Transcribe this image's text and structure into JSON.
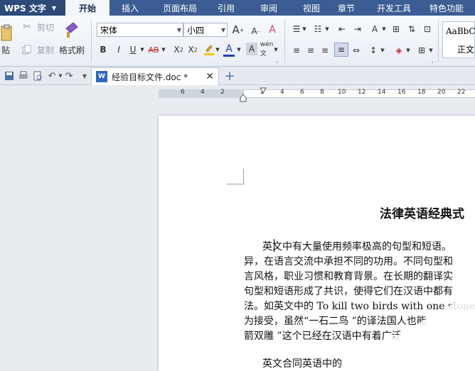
{
  "menu": {
    "app_name": "WPS 文字",
    "tabs": [
      "开始",
      "插入",
      "页面布局",
      "引用",
      "审阅",
      "视图",
      "章节",
      "开发工具",
      "特色功能"
    ]
  },
  "ribbon": {
    "paste": "贴",
    "cut": "剪切",
    "copy": "复制",
    "format_painter": "格式刷",
    "font_name": "宋体",
    "font_size": "小四",
    "style_preview": "AaBbC",
    "style_name": "正文"
  },
  "qbar": {
    "doc_name": "经验目标文件.doc *"
  },
  "ruler": {
    "ticks": [
      "6",
      "4",
      "2",
      "2",
      "4",
      "6",
      "8",
      "10",
      "12",
      "14",
      "16",
      "18",
      "20",
      "22"
    ]
  },
  "document": {
    "title": "法律英语经典式",
    "lines": [
      "英文中有大量使用频率极高的句型和短语。",
      "异，在语言交流中承担不同的功用。不同句型和",
      "言风格，职业习惯和教育背景。在长期的翻译实",
      "句型和短语形成了共识，使得它们在汉语中都有",
      "法。如英文中的 To kill two birds with one stone",
      "为接受，虽然“一石二鸟 ”的译法国人也能",
      "箭双雕 ”这个已经在汉语中有着广泛",
      "英文合同英语中的"
    ]
  },
  "colors": {
    "menubar": "#3b5d93",
    "highlight": "#f5c400",
    "font_color": "#1f3fb5"
  }
}
